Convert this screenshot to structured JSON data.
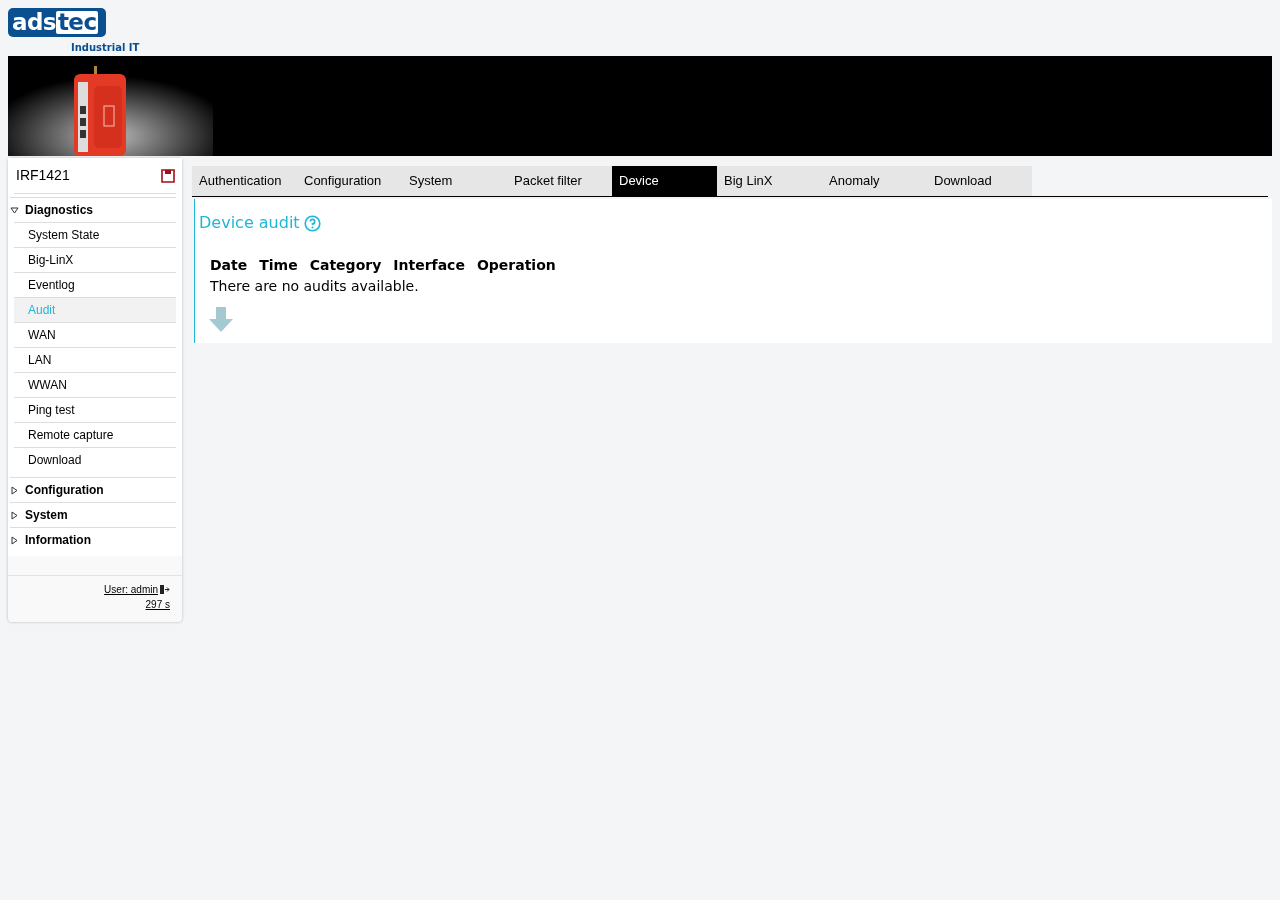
{
  "logo": {
    "part_1": "ads",
    "part_2": "tec",
    "tagline": "Industrial IT"
  },
  "sidebar": {
    "device": "IRF1421",
    "groups": [
      {
        "label": "Diagnostics",
        "expanded": true,
        "items": [
          {
            "label": "System State",
            "selected": false
          },
          {
            "label": "Big-LinX",
            "selected": false
          },
          {
            "label": "Eventlog",
            "selected": false
          },
          {
            "label": "Audit",
            "selected": true
          },
          {
            "label": "WAN",
            "selected": false
          },
          {
            "label": "LAN",
            "selected": false
          },
          {
            "label": "WWAN",
            "selected": false
          },
          {
            "label": "Ping test",
            "selected": false
          },
          {
            "label": "Remote capture",
            "selected": false
          },
          {
            "label": "Download",
            "selected": false
          }
        ]
      },
      {
        "label": "Configuration",
        "expanded": false
      },
      {
        "label": "System",
        "expanded": false
      },
      {
        "label": "Information",
        "expanded": false
      }
    ],
    "user": "User: admin",
    "timer": "297 s"
  },
  "tabs": [
    {
      "label": "Authentication",
      "selected": false
    },
    {
      "label": "Configuration",
      "selected": false
    },
    {
      "label": "System",
      "selected": false
    },
    {
      "label": "Packet filter",
      "selected": false
    },
    {
      "label": "Device",
      "selected": true
    },
    {
      "label": "Big LinX",
      "selected": false
    },
    {
      "label": "Anomaly",
      "selected": false
    },
    {
      "label": "Download",
      "selected": false
    }
  ],
  "panel": {
    "title": "Device audit",
    "columns": [
      "Date",
      "Time",
      "Category",
      "Interface",
      "Operation"
    ],
    "empty_message": "There are no audits available."
  }
}
